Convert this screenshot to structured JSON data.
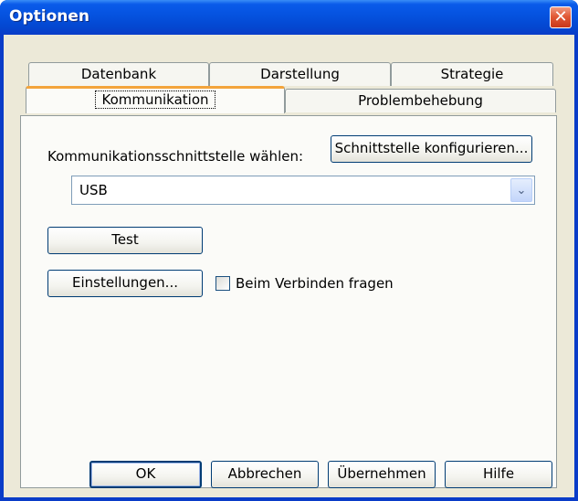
{
  "window": {
    "title": "Optionen",
    "close_glyph": "✕"
  },
  "tabs": {
    "row_back": [
      {
        "label": "Datenbank"
      },
      {
        "label": "Darstellung"
      },
      {
        "label": "Strategie"
      }
    ],
    "row_front": [
      {
        "label": "Kommunikation",
        "active": true
      },
      {
        "label": "Problembehebung"
      }
    ]
  },
  "kommunikation": {
    "interface_label": "Kommunikationsschnittstelle wählen:",
    "configure_button": "Schnittstelle konfigurieren...",
    "interface_select": {
      "value": "USB",
      "arrow_glyph": "⌄"
    },
    "test_button": "Test",
    "settings_button": "Einstellungen...",
    "ask_on_connect": {
      "label": "Beim Verbinden fragen",
      "checked": false
    }
  },
  "footer": {
    "ok": "OK",
    "cancel": "Abbrechen",
    "apply": "Übernehmen",
    "help": "Hilfe"
  },
  "colors": {
    "titlebar": "#0552df",
    "accent_tab": "#f3a43c",
    "dialog_bg": "#ece9d8",
    "close_button": "#e25a36"
  }
}
